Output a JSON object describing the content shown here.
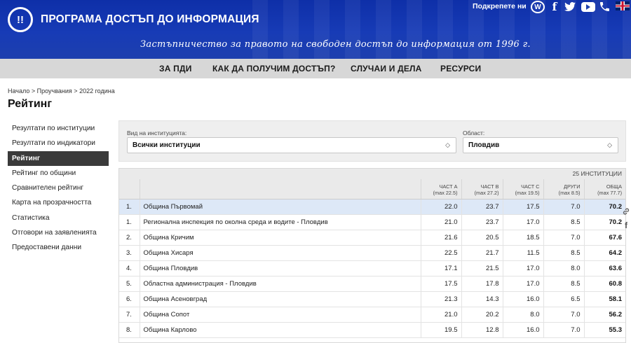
{
  "header": {
    "logo_text": "!!",
    "site_title": "ПРОГРАМА ДОСТЪП ДО ИНФОРМАЦИЯ",
    "tagline": "Застъпничество за правото на свободен достъп до информация от 1996 г.",
    "support_label": "Подкрепете ни"
  },
  "social_icons": [
    "wordpress-icon",
    "facebook-icon",
    "twitter-icon",
    "youtube-icon",
    "phone-icon",
    "uk-flag-icon"
  ],
  "nav": {
    "items": [
      "ЗА ПДИ",
      "КАК ДА ПОЛУЧИМ ДОСТЪП?",
      "СЛУЧАИ И ДЕЛА",
      "РЕСУРСИ"
    ]
  },
  "breadcrumb": {
    "items": [
      "Начало",
      "Проучвания",
      "2022 година"
    ],
    "separator": ">"
  },
  "page_title": "Рейтинг",
  "sidebar": {
    "items": [
      {
        "label": "Резултати по институции",
        "active": false
      },
      {
        "label": "Резултати по индикатори",
        "active": false
      },
      {
        "label": "Рейтинг",
        "active": true
      },
      {
        "label": "Рейтинг по общини",
        "active": false
      },
      {
        "label": "Сравнителен рейтинг",
        "active": false
      },
      {
        "label": "Карта на прозрачността",
        "active": false
      },
      {
        "label": "Статистика",
        "active": false
      },
      {
        "label": "Отговори на заявленията",
        "active": false
      },
      {
        "label": "Предоставени данни",
        "active": false
      }
    ]
  },
  "filters": {
    "institution_type": {
      "label": "Вид на институцията:",
      "value": "Всички институции"
    },
    "region": {
      "label": "Област:",
      "value": "Пловдив"
    }
  },
  "table": {
    "count_label": "25 ИНСТИТУЦИИ",
    "columns": [
      {
        "name": "",
        "sub": ""
      },
      {
        "name": "",
        "sub": ""
      },
      {
        "name": "ЧАСТ А",
        "sub": "(max 22.5)"
      },
      {
        "name": "ЧАСТ B",
        "sub": "(max 27.2)"
      },
      {
        "name": "ЧАСТ C",
        "sub": "(max 19.5)"
      },
      {
        "name": "ДРУГИ",
        "sub": "(max 8.5)"
      },
      {
        "name": "ОБЩА",
        "sub": "(max 77.7)"
      }
    ],
    "rows": [
      {
        "rank": "1.",
        "name": "Община Първомай",
        "a": "22.0",
        "b": "23.7",
        "c": "17.5",
        "other": "7.0",
        "total": "70.2",
        "highlight": true
      },
      {
        "rank": "1.",
        "name": "Регионална инспекция по околна среда и водите - Пловдив",
        "a": "21.0",
        "b": "23.7",
        "c": "17.0",
        "other": "8.5",
        "total": "70.2",
        "highlight": false
      },
      {
        "rank": "2.",
        "name": "Община Кричим",
        "a": "21.6",
        "b": "20.5",
        "c": "18.5",
        "other": "7.0",
        "total": "67.6",
        "highlight": false
      },
      {
        "rank": "3.",
        "name": "Община Хисаря",
        "a": "22.5",
        "b": "21.7",
        "c": "11.5",
        "other": "8.5",
        "total": "64.2",
        "highlight": false
      },
      {
        "rank": "4.",
        "name": "Община Пловдив",
        "a": "17.1",
        "b": "21.5",
        "c": "17.0",
        "other": "8.0",
        "total": "63.6",
        "highlight": false
      },
      {
        "rank": "5.",
        "name": "Областна администрация - Пловдив",
        "a": "17.5",
        "b": "17.8",
        "c": "17.0",
        "other": "8.5",
        "total": "60.8",
        "highlight": false
      },
      {
        "rank": "6.",
        "name": "Община Асеновград",
        "a": "21.3",
        "b": "14.3",
        "c": "16.0",
        "other": "6.5",
        "total": "58.1",
        "highlight": false
      },
      {
        "rank": "7.",
        "name": "Община Сопот",
        "a": "21.0",
        "b": "20.2",
        "c": "8.0",
        "other": "7.0",
        "total": "56.2",
        "highlight": false
      },
      {
        "rank": "8.",
        "name": "Община Карлово",
        "a": "19.5",
        "b": "12.8",
        "c": "16.0",
        "other": "7.0",
        "total": "55.3",
        "highlight": false
      }
    ]
  },
  "share_icons": [
    "link-icon",
    "facebook-share-icon"
  ]
}
